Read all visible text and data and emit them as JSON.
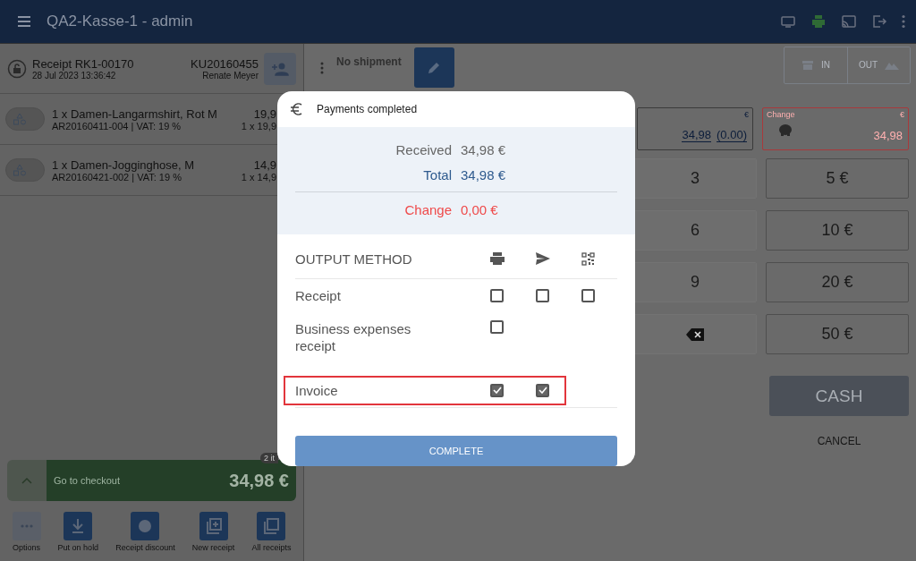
{
  "header": {
    "title": "QA2-Kasse-1 - admin"
  },
  "receipt": {
    "title": "Receipt RK1-00170",
    "date": "28 Jul 2023 13:36:42",
    "customer_number": "KU20160455",
    "customer_name": "Renate Meyer"
  },
  "items": [
    {
      "name": "1 x Damen-Langarmshirt, Rot M",
      "details": "AR20160411-004 | VAT: 19 %",
      "price": "19,9",
      "unit": "1 x 19,9"
    },
    {
      "name": "1 x Damen-Jogginghose, M",
      "details": "AR20160421-002 | VAT: 19 %",
      "price": "14,9",
      "unit": "1 x 14,9"
    }
  ],
  "checkout": {
    "label": "Go to checkout",
    "amount": "34,98 €",
    "badge": "2 it"
  },
  "actions": [
    {
      "label": "Options",
      "kind": "options"
    },
    {
      "label": "Put on hold",
      "kind": "hold"
    },
    {
      "label": "Receipt discount",
      "kind": "discount"
    },
    {
      "label": "New receipt",
      "kind": "new"
    },
    {
      "label": "All receipts",
      "kind": "all"
    }
  ],
  "shipment": {
    "label": "No shipment"
  },
  "direction": [
    {
      "label": "IN",
      "kind": "in"
    },
    {
      "label": "OUT",
      "kind": "out"
    }
  ],
  "payment_field": {
    "currency": "€",
    "amount": "34,98",
    "remainder": "(0.00)"
  },
  "change_field": {
    "label": "Change",
    "currency": "€",
    "amount": "34,98"
  },
  "keys": [
    {
      "kind": "digit",
      "label": "3"
    },
    {
      "kind": "digit",
      "label": "6"
    },
    {
      "kind": "digit",
      "label": "9"
    },
    {
      "kind": "backspace"
    }
  ],
  "cash_notes": [
    "5 €",
    "10 €",
    "20 €",
    "50 €"
  ],
  "cash_button": "CASH",
  "cancel_button": "CANCEL",
  "dialog": {
    "title": "Payments completed",
    "summary": [
      {
        "kind": "received",
        "label": "Received",
        "value": "34,98 €"
      },
      {
        "kind": "total",
        "label": "Total",
        "value": "34,98 €"
      },
      {
        "kind": "change",
        "label": "Change",
        "value": "0,00 €"
      }
    ],
    "output_heading": "OUTPUT METHOD",
    "outputs": [
      {
        "label": "Receipt",
        "highlighted": false,
        "options": [
          {
            "checked": false
          },
          {
            "checked": false
          },
          {
            "checked": false
          }
        ]
      },
      {
        "label": "Business expenses receipt",
        "highlighted": false,
        "options": [
          {
            "checked": false
          }
        ]
      },
      {
        "label": "Invoice",
        "highlighted": true,
        "options": [
          {
            "checked": true
          },
          {
            "checked": true
          }
        ]
      }
    ],
    "complete": "COMPLETE"
  }
}
